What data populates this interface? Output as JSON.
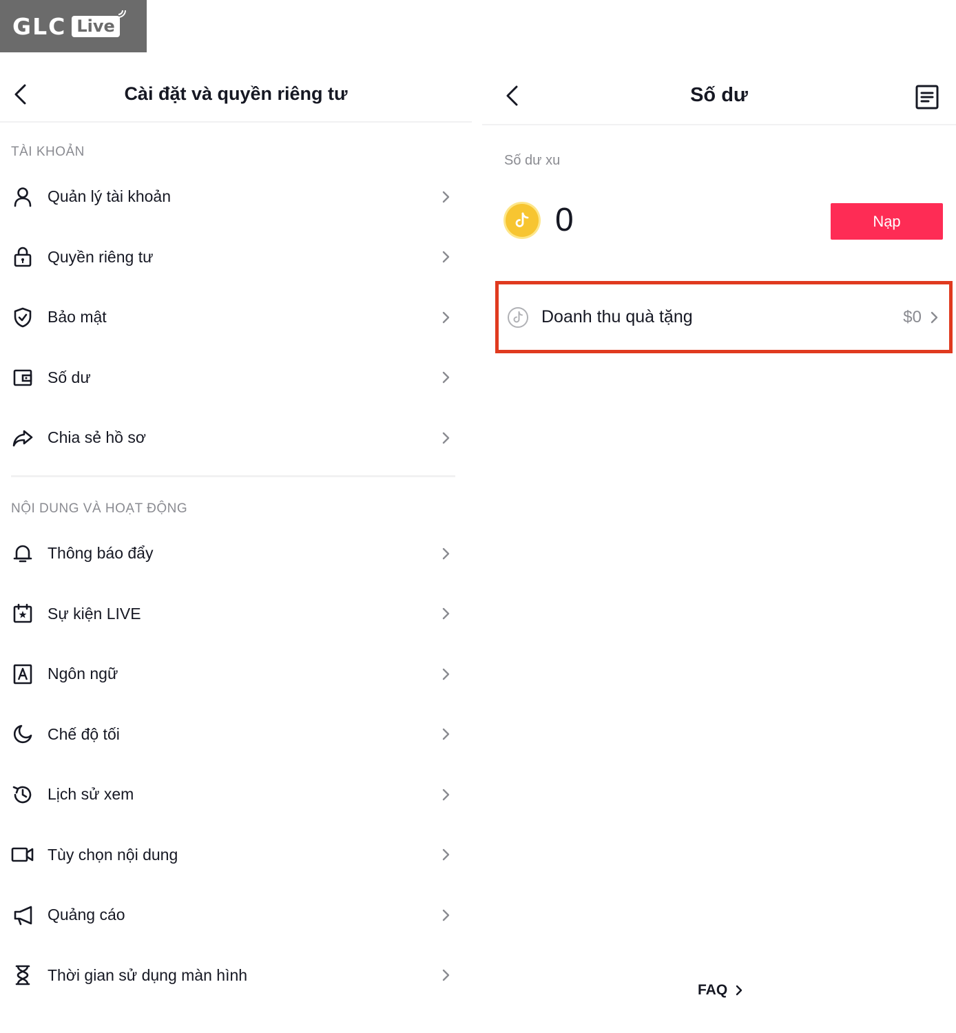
{
  "logo": {
    "brand": "GLC",
    "badge": "Live"
  },
  "left": {
    "title": "Cài đặt và quyền riêng tư",
    "section_account": "TÀI KHOẢN",
    "account_items": [
      {
        "label": "Quản lý tài khoản",
        "icon": "user-icon"
      },
      {
        "label": "Quyền riêng tư",
        "icon": "lock-icon"
      },
      {
        "label": "Bảo mật",
        "icon": "shield-icon"
      },
      {
        "label": "Số dư",
        "icon": "wallet-icon"
      },
      {
        "label": "Chia sẻ hồ sơ",
        "icon": "share-icon"
      }
    ],
    "section_content": "NỘI DUNG VÀ HOẠT ĐỘNG",
    "content_items": [
      {
        "label": "Thông báo đẩy",
        "icon": "bell-icon"
      },
      {
        "label": "Sự kiện LIVE",
        "icon": "calendar-icon"
      },
      {
        "label": "Ngôn ngữ",
        "icon": "language-icon"
      },
      {
        "label": "Chế độ tối",
        "icon": "moon-icon"
      },
      {
        "label": "Lịch sử xem",
        "icon": "history-icon"
      },
      {
        "label": "Tùy chọn nội dung",
        "icon": "video-icon"
      },
      {
        "label": "Quảng cáo",
        "icon": "megaphone-icon"
      },
      {
        "label": "Thời gian sử dụng màn hình",
        "icon": "hourglass-icon"
      }
    ]
  },
  "right": {
    "title": "Số dư",
    "balance_label": "Số dư xu",
    "balance_value": "0",
    "topup_label": "Nạp",
    "gift_label": "Doanh thu quà tặng",
    "gift_value": "$0",
    "faq_label": "FAQ"
  },
  "colors": {
    "accent": "#fe2c55",
    "highlight": "#e03a1f",
    "coin": "#f7c531"
  }
}
